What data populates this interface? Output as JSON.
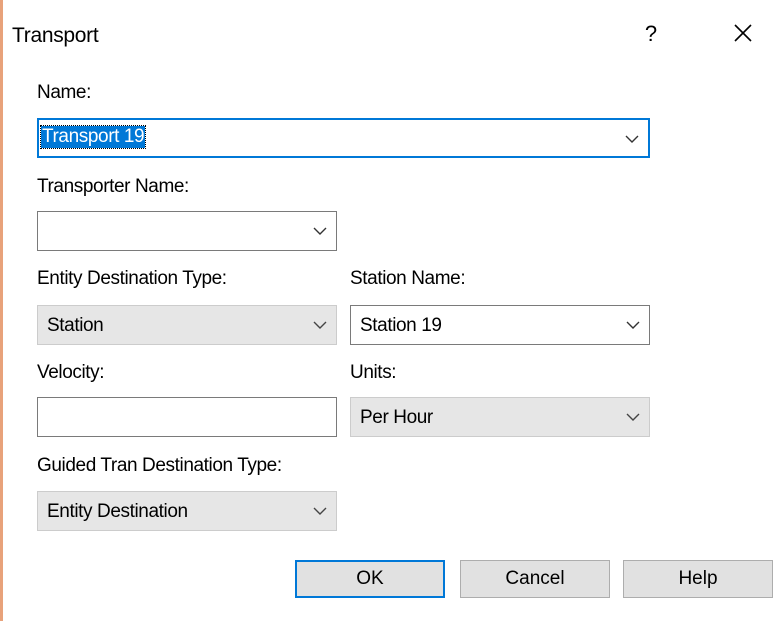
{
  "dialog": {
    "title": "Transport",
    "help_glyph": "?",
    "close_icon": "close-icon"
  },
  "fields": {
    "name": {
      "label": "Name:",
      "value": "Transport 19"
    },
    "transporter_name": {
      "label": "Transporter Name:",
      "value": ""
    },
    "entity_destination_type": {
      "label": "Entity Destination Type:",
      "value": "Station"
    },
    "station_name": {
      "label": "Station Name:",
      "value": "Station 19"
    },
    "velocity": {
      "label": "Velocity:",
      "value": ""
    },
    "units": {
      "label": "Units:",
      "value": "Per Hour"
    },
    "guided_tran_destination_type": {
      "label": "Guided Tran Destination Type:",
      "value": "Entity Destination"
    }
  },
  "buttons": {
    "ok": "OK",
    "cancel": "Cancel",
    "help": "Help"
  },
  "colors": {
    "accent": "#0078d7",
    "disabled_bg": "#e6e6e6",
    "button_bg": "#e1e1e1"
  }
}
